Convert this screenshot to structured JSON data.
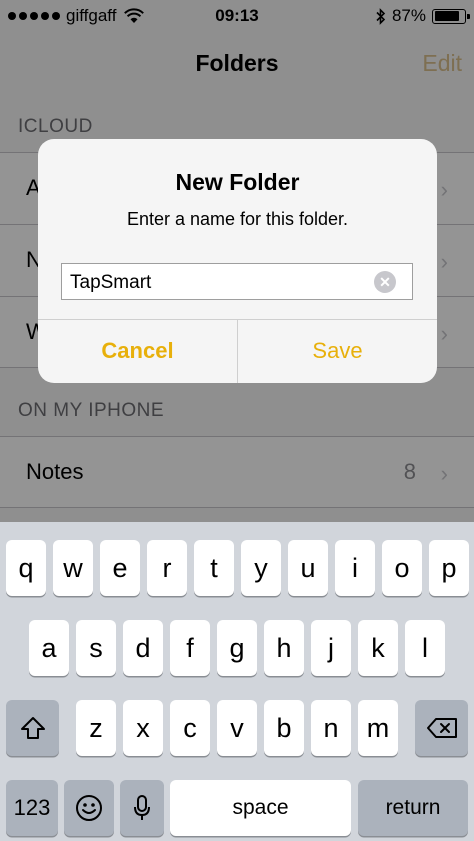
{
  "status_bar": {
    "carrier": "giffgaff",
    "time": "09:13",
    "battery_percent_label": "87%",
    "battery_level": 0.87
  },
  "nav": {
    "title": "Folders",
    "edit_label": "Edit"
  },
  "sections": {
    "icloud_header": "ICLOUD",
    "icloud_rows": [
      {
        "label_visible": "A"
      },
      {
        "label_visible": "N"
      },
      {
        "label_visible": "W"
      }
    ],
    "on_my_iphone_header": "ON MY IPHONE",
    "notes_row": {
      "label": "Notes",
      "count": "8"
    }
  },
  "alert": {
    "title": "New Folder",
    "message": "Enter a name for this folder.",
    "input_value": "TapSmart",
    "cancel_label": "Cancel",
    "save_label": "Save",
    "accent_color": "#e8b00b"
  },
  "keyboard": {
    "row1": [
      "q",
      "w",
      "e",
      "r",
      "t",
      "y",
      "u",
      "i",
      "o",
      "p"
    ],
    "row2": [
      "a",
      "s",
      "d",
      "f",
      "g",
      "h",
      "j",
      "k",
      "l"
    ],
    "row3": [
      "z",
      "x",
      "c",
      "v",
      "b",
      "n",
      "m"
    ],
    "numbers_label": "123",
    "space_label": "space",
    "return_label": "return"
  }
}
